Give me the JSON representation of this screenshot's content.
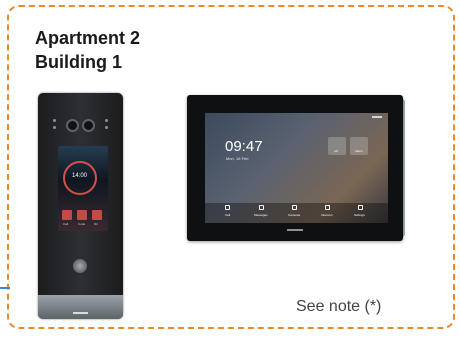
{
  "heading": {
    "line1": "Apartment 2",
    "line2": "Building 1"
  },
  "note": "See note (*)",
  "colors": {
    "frame": "#e8892b",
    "accent_tick": "#3a86d0"
  },
  "door_panel": {
    "time": "14:00",
    "menu_labels": [
      "Call",
      "Code",
      "Dir"
    ]
  },
  "monitor": {
    "time": "09:47",
    "date": "Mon, 16 Feb",
    "tiles": [
      "Lift",
      "Alarm"
    ],
    "bottom_bar": [
      "Call",
      "Messages",
      "Cameras",
      "Intercom",
      "Settings"
    ]
  }
}
